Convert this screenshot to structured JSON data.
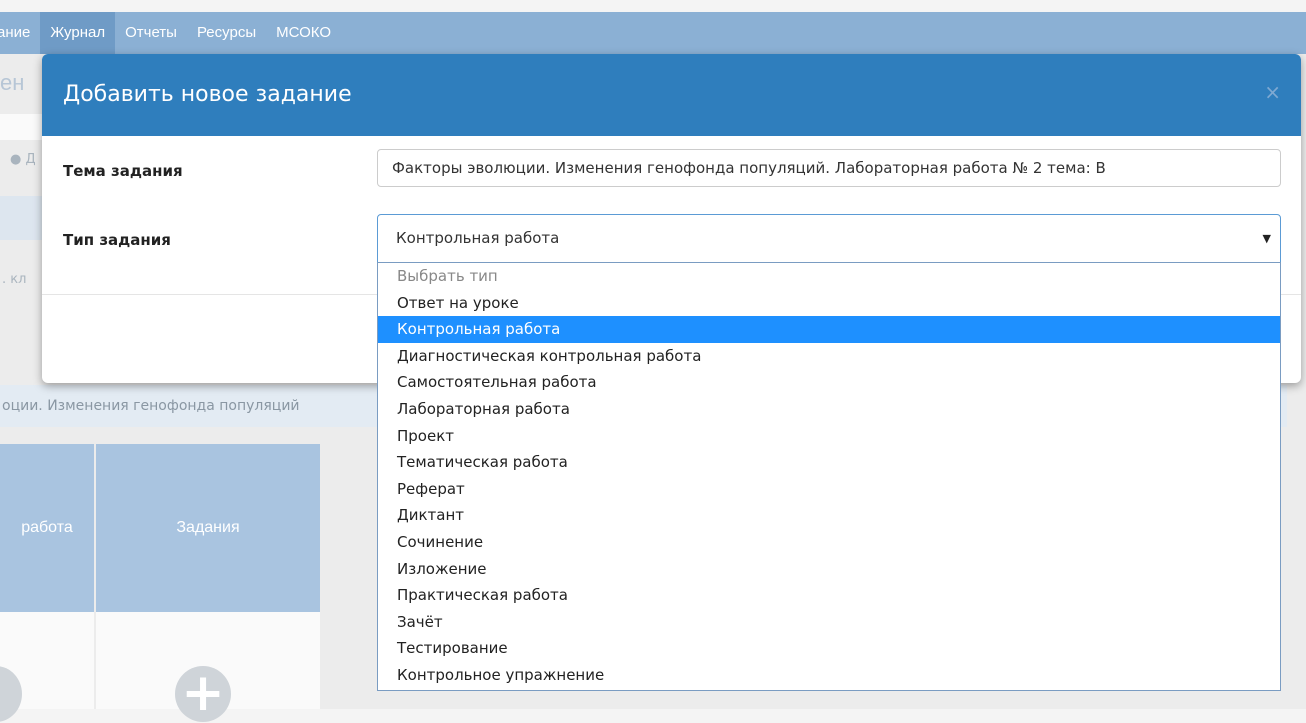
{
  "nav": {
    "items": [
      "ание",
      "Журнал",
      "Отчеты",
      "Ресурсы",
      "МСОКО"
    ],
    "active_index": 1
  },
  "background": {
    "heading_fragment": "ен",
    "add_fragment": "Д",
    "class_fragment": ". кл",
    "strip_text": "оции. Изменения генофонда популяций",
    "table": {
      "col1_header": "работа",
      "col2_header": "Задания"
    }
  },
  "modal": {
    "title": "Добавить новое задание",
    "close_label": "×",
    "fields": {
      "topic_label": "Тема задания",
      "topic_value": "Факторы эволюции. Изменения генофонда популяций. Лабораторная работа № 2 тема: В",
      "type_label": "Тип задания",
      "type_value": "Контрольная работа",
      "type_arrow": "▼"
    }
  },
  "dropdown": {
    "options": [
      "Выбрать тип",
      "Ответ на уроке",
      "Контрольная работа",
      "Диагностическая контрольная работа",
      "Самостоятельная работа",
      "Лабораторная работа",
      "Проект",
      "Тематическая работа",
      "Реферат",
      "Диктант",
      "Сочинение",
      "Изложение",
      "Практическая работа",
      "Зачёт",
      "Тестирование",
      "Контрольное упражнение"
    ],
    "selected_index": 2,
    "placeholder_index": 0
  },
  "colors": {
    "navbar": "#8bb0d4",
    "modal_header": "#2f7ebd",
    "selected_option": "#1e90ff"
  }
}
